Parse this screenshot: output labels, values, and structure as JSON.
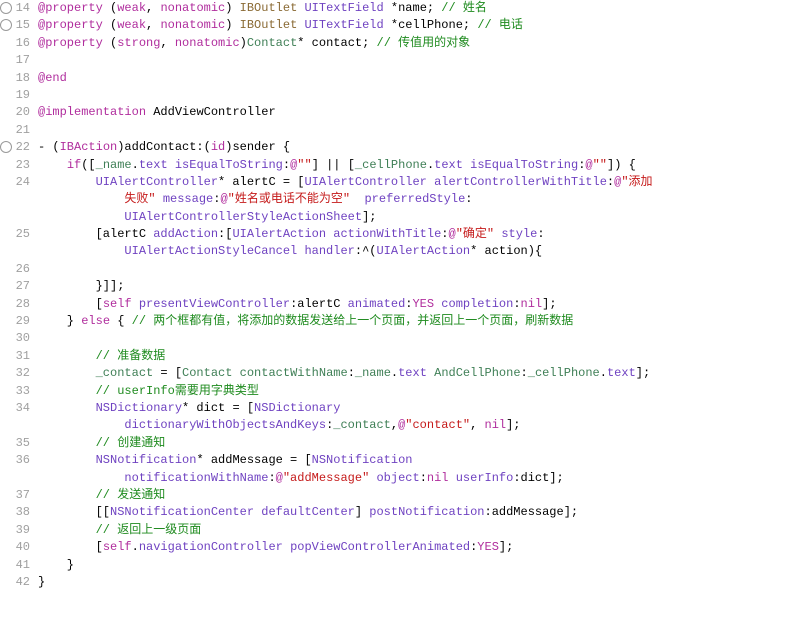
{
  "lines": [
    {
      "n": 14,
      "marker": true,
      "tokens": [
        {
          "c": "kw",
          "t": "@property"
        },
        {
          "c": "plain",
          "t": " ("
        },
        {
          "c": "kw",
          "t": "weak"
        },
        {
          "c": "plain",
          "t": ", "
        },
        {
          "c": "kw",
          "t": "nonatomic"
        },
        {
          "c": "plain",
          "t": ") "
        },
        {
          "c": "ib",
          "t": "IBOutlet"
        },
        {
          "c": "plain",
          "t": " "
        },
        {
          "c": "type",
          "t": "UITextField"
        },
        {
          "c": "plain",
          "t": " *name; "
        },
        {
          "c": "cmt",
          "t": "// 姓名"
        }
      ]
    },
    {
      "n": 15,
      "marker": true,
      "tokens": [
        {
          "c": "kw",
          "t": "@property"
        },
        {
          "c": "plain",
          "t": " ("
        },
        {
          "c": "kw",
          "t": "weak"
        },
        {
          "c": "plain",
          "t": ", "
        },
        {
          "c": "kw",
          "t": "nonatomic"
        },
        {
          "c": "plain",
          "t": ") "
        },
        {
          "c": "ib",
          "t": "IBOutlet"
        },
        {
          "c": "plain",
          "t": " "
        },
        {
          "c": "type",
          "t": "UITextField"
        },
        {
          "c": "plain",
          "t": " *cellPhone; "
        },
        {
          "c": "cmt",
          "t": "// 电话"
        }
      ]
    },
    {
      "n": 16,
      "tokens": [
        {
          "c": "kw",
          "t": "@property"
        },
        {
          "c": "plain",
          "t": " ("
        },
        {
          "c": "kw",
          "t": "strong"
        },
        {
          "c": "plain",
          "t": ", "
        },
        {
          "c": "kw",
          "t": "nonatomic"
        },
        {
          "c": "plain",
          "t": ")"
        },
        {
          "c": "usr",
          "t": "Contact"
        },
        {
          "c": "plain",
          "t": "* contact; "
        },
        {
          "c": "cmt",
          "t": "// 传值用的对象"
        }
      ]
    },
    {
      "n": 17,
      "tokens": []
    },
    {
      "n": 18,
      "tokens": [
        {
          "c": "kw",
          "t": "@end"
        }
      ]
    },
    {
      "n": 19,
      "tokens": []
    },
    {
      "n": 20,
      "tokens": [
        {
          "c": "kw",
          "t": "@implementation"
        },
        {
          "c": "plain",
          "t": " AddViewController"
        }
      ]
    },
    {
      "n": 21,
      "tokens": []
    },
    {
      "n": 22,
      "marker": true,
      "tokens": [
        {
          "c": "plain",
          "t": "- ("
        },
        {
          "c": "kw",
          "t": "IBAction"
        },
        {
          "c": "plain",
          "t": ")addContact:("
        },
        {
          "c": "kw",
          "t": "id"
        },
        {
          "c": "plain",
          "t": ")sender {"
        }
      ]
    },
    {
      "n": 23,
      "tokens": [
        {
          "c": "plain",
          "t": "    "
        },
        {
          "c": "kw",
          "t": "if"
        },
        {
          "c": "plain",
          "t": "(["
        },
        {
          "c": "iv",
          "t": "_name"
        },
        {
          "c": "plain",
          "t": "."
        },
        {
          "c": "type",
          "t": "text"
        },
        {
          "c": "plain",
          "t": " "
        },
        {
          "c": "type",
          "t": "isEqualToString"
        },
        {
          "c": "plain",
          "t": ":"
        },
        {
          "c": "at",
          "t": "@"
        },
        {
          "c": "str",
          "t": "\"\""
        },
        {
          "c": "plain",
          "t": "] || ["
        },
        {
          "c": "iv",
          "t": "_cellPhone"
        },
        {
          "c": "plain",
          "t": "."
        },
        {
          "c": "type",
          "t": "text"
        },
        {
          "c": "plain",
          "t": " "
        },
        {
          "c": "type",
          "t": "isEqualToString"
        },
        {
          "c": "plain",
          "t": ":"
        },
        {
          "c": "at",
          "t": "@"
        },
        {
          "c": "str",
          "t": "\"\""
        },
        {
          "c": "plain",
          "t": "]) {"
        }
      ]
    },
    {
      "n": 24,
      "tokens": [
        {
          "c": "plain",
          "t": "        "
        },
        {
          "c": "type",
          "t": "UIAlertController"
        },
        {
          "c": "plain",
          "t": "* alertC = ["
        },
        {
          "c": "type",
          "t": "UIAlertController"
        },
        {
          "c": "plain",
          "t": " "
        },
        {
          "c": "type",
          "t": "alertControllerWithTitle"
        },
        {
          "c": "plain",
          "t": ":"
        },
        {
          "c": "at",
          "t": "@"
        },
        {
          "c": "str",
          "t": "\"添加"
        }
      ]
    },
    {
      "n": null,
      "tokens": [
        {
          "c": "plain",
          "t": "            "
        },
        {
          "c": "str",
          "t": "失败\""
        },
        {
          "c": "plain",
          "t": " "
        },
        {
          "c": "type",
          "t": "message"
        },
        {
          "c": "plain",
          "t": ":"
        },
        {
          "c": "at",
          "t": "@"
        },
        {
          "c": "str",
          "t": "\"姓名或电话不能为空\""
        },
        {
          "c": "plain",
          "t": "  "
        },
        {
          "c": "type",
          "t": "preferredStyle"
        },
        {
          "c": "plain",
          "t": ":"
        }
      ]
    },
    {
      "n": null,
      "tokens": [
        {
          "c": "plain",
          "t": "            "
        },
        {
          "c": "enum",
          "t": "UIAlertControllerStyleActionSheet"
        },
        {
          "c": "plain",
          "t": "];"
        }
      ]
    },
    {
      "n": 25,
      "tokens": [
        {
          "c": "plain",
          "t": "        [alertC "
        },
        {
          "c": "type",
          "t": "addAction"
        },
        {
          "c": "plain",
          "t": ":["
        },
        {
          "c": "type",
          "t": "UIAlertAction"
        },
        {
          "c": "plain",
          "t": " "
        },
        {
          "c": "type",
          "t": "actionWithTitle"
        },
        {
          "c": "plain",
          "t": ":"
        },
        {
          "c": "at",
          "t": "@"
        },
        {
          "c": "str",
          "t": "\"确定\""
        },
        {
          "c": "plain",
          "t": " "
        },
        {
          "c": "type",
          "t": "style"
        },
        {
          "c": "plain",
          "t": ":"
        }
      ]
    },
    {
      "n": null,
      "tokens": [
        {
          "c": "plain",
          "t": "            "
        },
        {
          "c": "enum",
          "t": "UIAlertActionStyleCancel"
        },
        {
          "c": "plain",
          "t": " "
        },
        {
          "c": "type",
          "t": "handler"
        },
        {
          "c": "plain",
          "t": ":^("
        },
        {
          "c": "type",
          "t": "UIAlertAction"
        },
        {
          "c": "plain",
          "t": "* action){"
        }
      ]
    },
    {
      "n": 26,
      "tokens": []
    },
    {
      "n": 27,
      "tokens": [
        {
          "c": "plain",
          "t": "        }]];"
        }
      ]
    },
    {
      "n": 28,
      "tokens": [
        {
          "c": "plain",
          "t": "        ["
        },
        {
          "c": "kw",
          "t": "self"
        },
        {
          "c": "plain",
          "t": " "
        },
        {
          "c": "type",
          "t": "presentViewController"
        },
        {
          "c": "plain",
          "t": ":alertC "
        },
        {
          "c": "type",
          "t": "animated"
        },
        {
          "c": "plain",
          "t": ":"
        },
        {
          "c": "kw",
          "t": "YES"
        },
        {
          "c": "plain",
          "t": " "
        },
        {
          "c": "type",
          "t": "completion"
        },
        {
          "c": "plain",
          "t": ":"
        },
        {
          "c": "kw",
          "t": "nil"
        },
        {
          "c": "plain",
          "t": "];"
        }
      ]
    },
    {
      "n": 29,
      "tokens": [
        {
          "c": "plain",
          "t": "    } "
        },
        {
          "c": "kw",
          "t": "else"
        },
        {
          "c": "plain",
          "t": " { "
        },
        {
          "c": "cmt",
          "t": "// 两个框都有值，将添加的数据发送给上一个页面，并返回上一个页面，刷新数据"
        }
      ]
    },
    {
      "n": 30,
      "tokens": []
    },
    {
      "n": 31,
      "tokens": [
        {
          "c": "plain",
          "t": "        "
        },
        {
          "c": "cmt",
          "t": "// 准备数据"
        }
      ]
    },
    {
      "n": 32,
      "tokens": [
        {
          "c": "plain",
          "t": "        "
        },
        {
          "c": "iv",
          "t": "_contact"
        },
        {
          "c": "plain",
          "t": " = ["
        },
        {
          "c": "usr",
          "t": "Contact"
        },
        {
          "c": "plain",
          "t": " "
        },
        {
          "c": "usr",
          "t": "contactWithName"
        },
        {
          "c": "plain",
          "t": ":"
        },
        {
          "c": "iv",
          "t": "_name"
        },
        {
          "c": "plain",
          "t": "."
        },
        {
          "c": "type",
          "t": "text"
        },
        {
          "c": "plain",
          "t": " "
        },
        {
          "c": "usr",
          "t": "AndCellPhone"
        },
        {
          "c": "plain",
          "t": ":"
        },
        {
          "c": "iv",
          "t": "_cellPhone"
        },
        {
          "c": "plain",
          "t": "."
        },
        {
          "c": "type",
          "t": "text"
        },
        {
          "c": "plain",
          "t": "];"
        }
      ]
    },
    {
      "n": 33,
      "tokens": [
        {
          "c": "plain",
          "t": "        "
        },
        {
          "c": "cmt",
          "t": "// userInfo需要用字典类型"
        }
      ]
    },
    {
      "n": 34,
      "tokens": [
        {
          "c": "plain",
          "t": "        "
        },
        {
          "c": "type",
          "t": "NSDictionary"
        },
        {
          "c": "plain",
          "t": "* dict = ["
        },
        {
          "c": "type",
          "t": "NSDictionary"
        }
      ]
    },
    {
      "n": null,
      "tokens": [
        {
          "c": "plain",
          "t": "            "
        },
        {
          "c": "type",
          "t": "dictionaryWithObjectsAndKeys"
        },
        {
          "c": "plain",
          "t": ":"
        },
        {
          "c": "iv",
          "t": "_contact"
        },
        {
          "c": "plain",
          "t": ","
        },
        {
          "c": "at",
          "t": "@"
        },
        {
          "c": "str",
          "t": "\"contact\""
        },
        {
          "c": "plain",
          "t": ", "
        },
        {
          "c": "kw",
          "t": "nil"
        },
        {
          "c": "plain",
          "t": "];"
        }
      ]
    },
    {
      "n": 35,
      "tokens": [
        {
          "c": "plain",
          "t": "        "
        },
        {
          "c": "cmt",
          "t": "// 创建通知"
        }
      ]
    },
    {
      "n": 36,
      "tokens": [
        {
          "c": "plain",
          "t": "        "
        },
        {
          "c": "type",
          "t": "NSNotification"
        },
        {
          "c": "plain",
          "t": "* addMessage = ["
        },
        {
          "c": "type",
          "t": "NSNotification"
        }
      ]
    },
    {
      "n": null,
      "tokens": [
        {
          "c": "plain",
          "t": "            "
        },
        {
          "c": "type",
          "t": "notificationWithName"
        },
        {
          "c": "plain",
          "t": ":"
        },
        {
          "c": "at",
          "t": "@"
        },
        {
          "c": "str",
          "t": "\"addMessage\""
        },
        {
          "c": "plain",
          "t": " "
        },
        {
          "c": "type",
          "t": "object"
        },
        {
          "c": "plain",
          "t": ":"
        },
        {
          "c": "kw",
          "t": "nil"
        },
        {
          "c": "plain",
          "t": " "
        },
        {
          "c": "type",
          "t": "userInfo"
        },
        {
          "c": "plain",
          "t": ":dict];"
        }
      ]
    },
    {
      "n": 37,
      "tokens": [
        {
          "c": "plain",
          "t": "        "
        },
        {
          "c": "cmt",
          "t": "// 发送通知"
        }
      ]
    },
    {
      "n": 38,
      "tokens": [
        {
          "c": "plain",
          "t": "        [["
        },
        {
          "c": "type",
          "t": "NSNotificationCenter"
        },
        {
          "c": "plain",
          "t": " "
        },
        {
          "c": "type",
          "t": "defaultCenter"
        },
        {
          "c": "plain",
          "t": "] "
        },
        {
          "c": "type",
          "t": "postNotification"
        },
        {
          "c": "plain",
          "t": ":addMessage];"
        }
      ]
    },
    {
      "n": 39,
      "tokens": [
        {
          "c": "plain",
          "t": "        "
        },
        {
          "c": "cmt",
          "t": "// 返回上一级页面"
        }
      ]
    },
    {
      "n": 40,
      "tokens": [
        {
          "c": "plain",
          "t": "        ["
        },
        {
          "c": "kw",
          "t": "self"
        },
        {
          "c": "plain",
          "t": "."
        },
        {
          "c": "type",
          "t": "navigationController"
        },
        {
          "c": "plain",
          "t": " "
        },
        {
          "c": "type",
          "t": "popViewControllerAnimated"
        },
        {
          "c": "plain",
          "t": ":"
        },
        {
          "c": "kw",
          "t": "YES"
        },
        {
          "c": "plain",
          "t": "];"
        }
      ]
    },
    {
      "n": 41,
      "tokens": [
        {
          "c": "plain",
          "t": "    }"
        }
      ]
    },
    {
      "n": 42,
      "tokens": [
        {
          "c": "plain",
          "t": "}"
        }
      ]
    }
  ]
}
